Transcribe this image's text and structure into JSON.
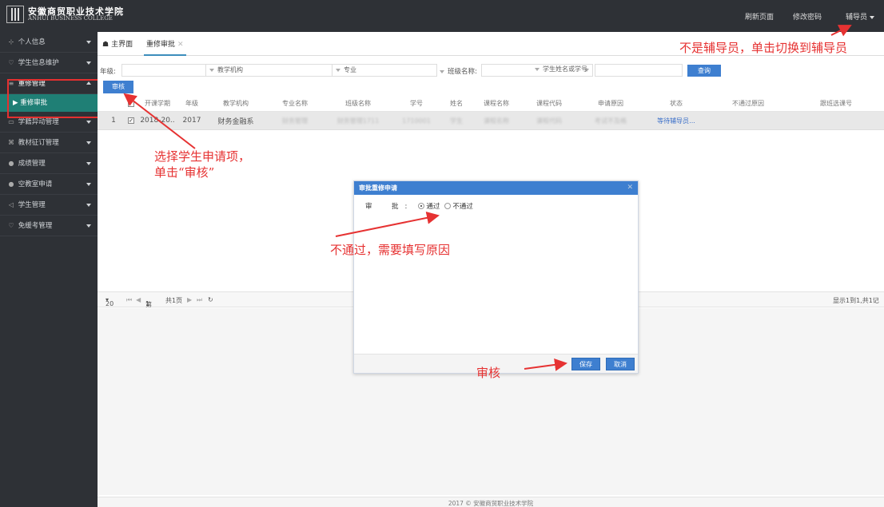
{
  "header": {
    "logo_cn": "安徽商贸职业技术学院",
    "logo_en": "ANHUI BUSINESS COLLEGE",
    "refresh": "刷新页面",
    "change_password": "修改密码",
    "role": "辅导员"
  },
  "sidebar": {
    "items": [
      {
        "icon": "person-icon",
        "label": "个人信息"
      },
      {
        "icon": "student-icon",
        "label": "学生信息维护"
      },
      {
        "icon": "list-icon",
        "label": "重修管理"
      },
      {
        "icon": "card-icon",
        "label": "学籍异动管理"
      },
      {
        "icon": "book-icon",
        "label": "教材征订管理"
      },
      {
        "icon": "dot-icon",
        "label": "成绩管理"
      },
      {
        "icon": "dot-icon",
        "label": "空教室申请"
      },
      {
        "icon": "send-icon",
        "label": "学生管理"
      },
      {
        "icon": "shield-icon",
        "label": "免缓考管理"
      }
    ],
    "sub_item": "重修审批"
  },
  "tabs": {
    "home": "主界面",
    "active": "重修审批"
  },
  "filters": {
    "grade_label": "年级:",
    "org_placeholder": "教学机构",
    "major_placeholder": "专业",
    "class_label": "班级名称:",
    "student_placeholder": "学生姓名或学号",
    "query_button": "查询"
  },
  "toolbar": {
    "review_button": "审核"
  },
  "table": {
    "columns": [
      "开课学期",
      "年级",
      "教学机构",
      "专业名称",
      "班级名称",
      "学号",
      "姓名",
      "课程名称",
      "课程代码",
      "申请原因",
      "状态",
      "不通过原因",
      "跟班选课号"
    ],
    "row": {
      "index": "1",
      "term": "2018-20..",
      "grade": "2017",
      "org": "财务金融系",
      "major": "财务管理",
      "class": "财务管理1711",
      "student_no": "1710001",
      "name": "学生",
      "course": "课程名称",
      "course_code": "课程代码",
      "reason": "考试不及格",
      "status": "等待辅导员..."
    }
  },
  "pager": {
    "page_size": "20",
    "page_prefix": "第",
    "page_num": "1",
    "total_pages": "共1页",
    "summary": "显示1到1,共1记"
  },
  "modal": {
    "title": "审批重修申请",
    "approve_label": "审　批:",
    "pass": "通过",
    "fail": "不通过",
    "save": "保存",
    "cancel": "取消"
  },
  "footer": "2017 © 安徽商贸职业技术学院",
  "annotations": {
    "switch_role": "不是辅导员，单击切换到辅导员",
    "select_line1": "选择学生申请项，",
    "select_line2": "单击“审核”",
    "reason": "不通过，需要填写原因",
    "review": "审核"
  },
  "colors": {
    "sidebar_bg": "#2e3136",
    "accent_blue": "#3e7fd0",
    "active_menu": "#1f7f75",
    "annotation_red": "#e63232"
  }
}
